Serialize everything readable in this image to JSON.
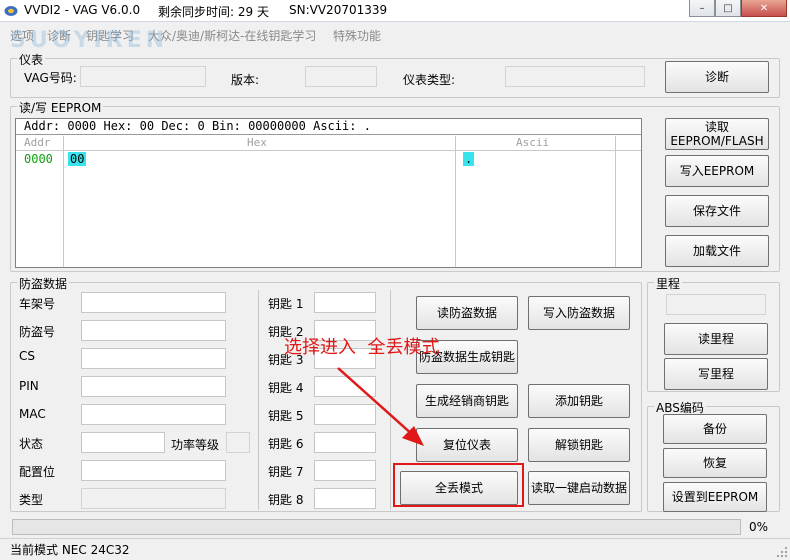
{
  "window": {
    "title": "VVDI2 - VAG V6.0.0",
    "sync_label": "剩余同步时间: 29 天",
    "sn_label": "SN:VV20701339",
    "minimize": "–",
    "maximize": "□",
    "close": "✕"
  },
  "menu": [
    "选项",
    "诊断",
    "钥匙学习",
    "大众/奥迪/斯柯达-在线钥匙学习",
    "特殊功能"
  ],
  "watermark": "SUOYIREN",
  "instrument": {
    "title": "仪表",
    "vag_label": "VAG号码:",
    "version_label": "版本:",
    "type_label": "仪表类型:",
    "diagnose_button": "诊断"
  },
  "eeprom": {
    "title": "读/写 EEPROM",
    "info": {
      "addr_label": "Addr:",
      "addr": "0000",
      "hex_label": "Hex:",
      "hex": "00",
      "dec_label": "Dec:",
      "dec": "0",
      "bin_label": "Bin:",
      "bin": "00000000",
      "ascii_label": "Ascii:",
      "ascii": "."
    },
    "columns": {
      "addr": "Addr",
      "hex": "Hex",
      "ascii": "Ascii"
    },
    "rows": [
      {
        "addr": "0000",
        "hex": "00",
        "ascii": "."
      }
    ],
    "buttons": {
      "read": "读取\nEEPROM/FLASH",
      "write": "写入EEPROM",
      "save": "保存文件",
      "load": "加载文件"
    }
  },
  "immo": {
    "title": "防盗数据",
    "fields": {
      "vin": "车架号",
      "immo": "防盗号",
      "cs": "CS",
      "pin": "PIN",
      "mac": "MAC",
      "status": "状态",
      "power_level": "功率等级",
      "config": "配置位",
      "type": "类型"
    },
    "keys": [
      "钥匙 1",
      "钥匙 2",
      "钥匙 3",
      "钥匙 4",
      "钥匙 5",
      "钥匙 6",
      "钥匙 7",
      "钥匙 8"
    ],
    "buttons": {
      "read_immo": "读防盗数据",
      "write_immo": "写入防盗数据",
      "gen_key": "防盗数据生成钥匙",
      "dealer_key": "生成经销商钥匙",
      "add_key": "添加钥匙",
      "reset": "复位仪表",
      "unlock_key": "解锁钥匙",
      "all_lost": "全丢模式",
      "read_start": "读取一键启动数据"
    }
  },
  "mileage": {
    "title": "里程",
    "read": "读里程",
    "write": "写里程"
  },
  "abs": {
    "title": "ABS编码",
    "backup": "备份",
    "restore": "恢复",
    "set_eeprom": "设置到EEPROM"
  },
  "annotation": {
    "text": "选择进入  全丢模式",
    "color": "#e01818"
  },
  "progress": {
    "value": 0,
    "label": "0%"
  },
  "status": {
    "mode": "当前模式 NEC 24C32"
  }
}
